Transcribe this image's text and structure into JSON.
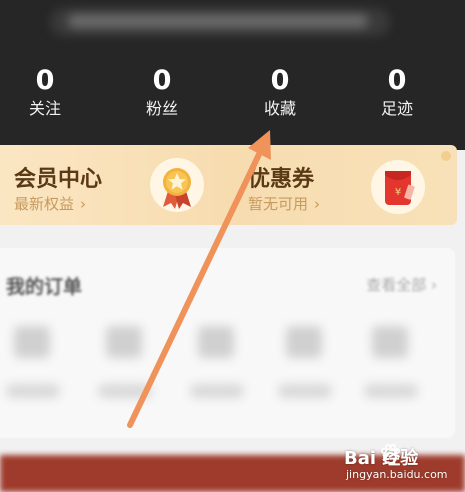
{
  "stats": [
    {
      "value": "0",
      "label": "关注"
    },
    {
      "value": "0",
      "label": "粉丝"
    },
    {
      "value": "0",
      "label": "收藏"
    },
    {
      "value": "0",
      "label": "足迹"
    }
  ],
  "promo": {
    "vip_title": "会员中心",
    "vip_sub": "最新权益",
    "coupon_title": "优惠券",
    "coupon_sub": "暂无可用",
    "chevron": "›"
  },
  "orders": {
    "title": "我的订单",
    "more": "查看全部",
    "more_chevron": "›"
  },
  "watermark": {
    "brand": "Bai  经验",
    "url": "jingyan.baidu.com"
  },
  "colors": {
    "header_bg": "#262626",
    "promo_bg": "#f7dcb0",
    "promo_title": "#5a3a15",
    "promo_sub": "#c79a5d",
    "arrow": "#f0935a"
  },
  "icons": [
    "medal-icon",
    "red-envelope-icon",
    "chevron-right-icon",
    "arrow-annotation-icon",
    "paw-icon"
  ]
}
